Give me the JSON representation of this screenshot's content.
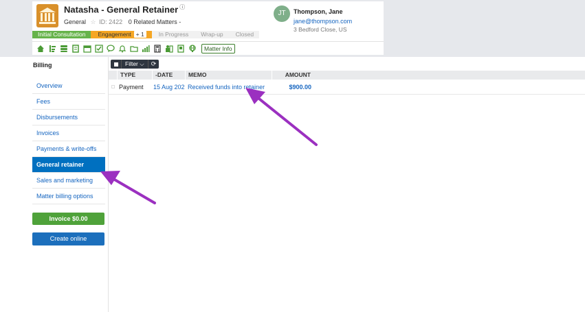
{
  "matter": {
    "title": "Natasha - General Retainer",
    "info_glyph": "ⓘ",
    "practice_area": "General",
    "star_glyph": "☆",
    "id_label": "ID: 2422",
    "related": "0 Related Matters -"
  },
  "contact": {
    "initials": "JT",
    "name": "Thompson, Jane",
    "email": "jane@thompson.com",
    "address": "3 Bedford Close, US",
    "avatar_color": "#7faf8a"
  },
  "stages": {
    "initial": "Initial Consultation",
    "engagement": "Engagement",
    "engagement_count": "+ 1",
    "in_progress": "In Progress",
    "wrap_up": "Wrap-up",
    "closed": "Closed"
  },
  "toolbar": {
    "icons": [
      "home-icon",
      "timeline-icon",
      "database-icon",
      "notes-icon",
      "calendar-icon",
      "checklist-icon",
      "chat-icon",
      "bell-icon",
      "folder-icon",
      "chart-icon",
      "calculator-icon",
      "billing-icon",
      "document-icon",
      "globe-icon"
    ],
    "matter_info": "Matter Info"
  },
  "sidebar": {
    "title": "Billing",
    "items": [
      {
        "label": "Overview"
      },
      {
        "label": "Fees"
      },
      {
        "label": "Disbursements"
      },
      {
        "label": "Invoices"
      },
      {
        "label": "Payments & write-offs"
      },
      {
        "label": "General retainer"
      },
      {
        "label": "Sales and marketing"
      },
      {
        "label": "Matter billing options"
      }
    ],
    "active_index": 5
  },
  "buttons": {
    "invoice": "Invoice $0.00",
    "create_online": "Create online"
  },
  "filter_bar": {
    "filter_label": "Filter",
    "chevron_glyph": "⌵",
    "refresh_glyph": "⟳"
  },
  "grid": {
    "columns": [
      "TYPE",
      "-DATE",
      "MEMO",
      "AMOUNT"
    ],
    "rows": [
      {
        "type": "Payment",
        "date": "15 Aug 202",
        "memo": "Received funds into retainer",
        "amount": "$900.00"
      }
    ]
  },
  "colors": {
    "accent_blue": "#0070c0",
    "green": "#4fa23a",
    "annotation_arrow": "#9b30c0"
  }
}
